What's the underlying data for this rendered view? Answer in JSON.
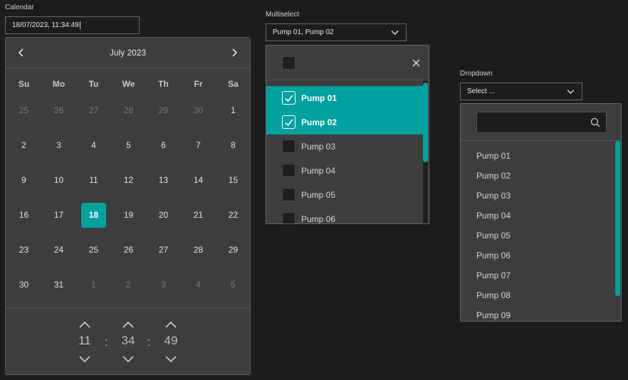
{
  "calendar": {
    "label": "Calendar",
    "value": "18/07/2023, 11:34:49",
    "month_label": "July  2023",
    "weekdays": [
      "Su",
      "Mo",
      "Tu",
      "We",
      "Th",
      "Fr",
      "Sa"
    ],
    "weeks": [
      [
        {
          "d": "25",
          "m": true
        },
        {
          "d": "26",
          "m": true
        },
        {
          "d": "27",
          "m": true
        },
        {
          "d": "28",
          "m": true
        },
        {
          "d": "29",
          "m": true
        },
        {
          "d": "30",
          "m": true
        },
        {
          "d": "1"
        }
      ],
      [
        {
          "d": "2"
        },
        {
          "d": "3"
        },
        {
          "d": "4"
        },
        {
          "d": "5"
        },
        {
          "d": "6"
        },
        {
          "d": "7"
        },
        {
          "d": "8"
        }
      ],
      [
        {
          "d": "9"
        },
        {
          "d": "10"
        },
        {
          "d": "11"
        },
        {
          "d": "12"
        },
        {
          "d": "13"
        },
        {
          "d": "14"
        },
        {
          "d": "15"
        }
      ],
      [
        {
          "d": "16"
        },
        {
          "d": "17"
        },
        {
          "d": "18",
          "sel": true
        },
        {
          "d": "19"
        },
        {
          "d": "20"
        },
        {
          "d": "21"
        },
        {
          "d": "22"
        }
      ],
      [
        {
          "d": "23"
        },
        {
          "d": "24"
        },
        {
          "d": "25"
        },
        {
          "d": "26"
        },
        {
          "d": "27"
        },
        {
          "d": "28"
        },
        {
          "d": "29"
        }
      ],
      [
        {
          "d": "30"
        },
        {
          "d": "31"
        },
        {
          "d": "1",
          "m": true
        },
        {
          "d": "2",
          "m": true
        },
        {
          "d": "3",
          "m": true
        },
        {
          "d": "4",
          "m": true
        },
        {
          "d": "5",
          "m": true
        }
      ]
    ],
    "time": {
      "hours": "11",
      "minutes": "34",
      "seconds": "49",
      "separator": ":"
    },
    "icons": {
      "prev": "chevron-left-icon",
      "next": "chevron-right-icon",
      "up": "chevron-up-icon",
      "down": "chevron-down-icon"
    }
  },
  "multiselect": {
    "label": "Multiselect",
    "value": "Pump 01, Pump 02",
    "items": [
      {
        "label": "Pump 01",
        "checked": true
      },
      {
        "label": "Pump 02",
        "checked": true
      },
      {
        "label": "Pump 03",
        "checked": false
      },
      {
        "label": "Pump 04",
        "checked": false
      },
      {
        "label": "Pump 05",
        "checked": false
      },
      {
        "label": "Pump 06",
        "checked": false
      }
    ]
  },
  "dropdown": {
    "label": "Dropdown",
    "value": "Select ...",
    "search_value": "",
    "items": [
      "Pump 01",
      "Pump 02",
      "Pump 03",
      "Pump 04",
      "Pump 05",
      "Pump 06",
      "Pump 07",
      "Pump 08",
      "Pump 09"
    ]
  },
  "colors": {
    "accent": "#00a19f",
    "panel": "#3d3d3d",
    "background": "#1b1c1e"
  }
}
